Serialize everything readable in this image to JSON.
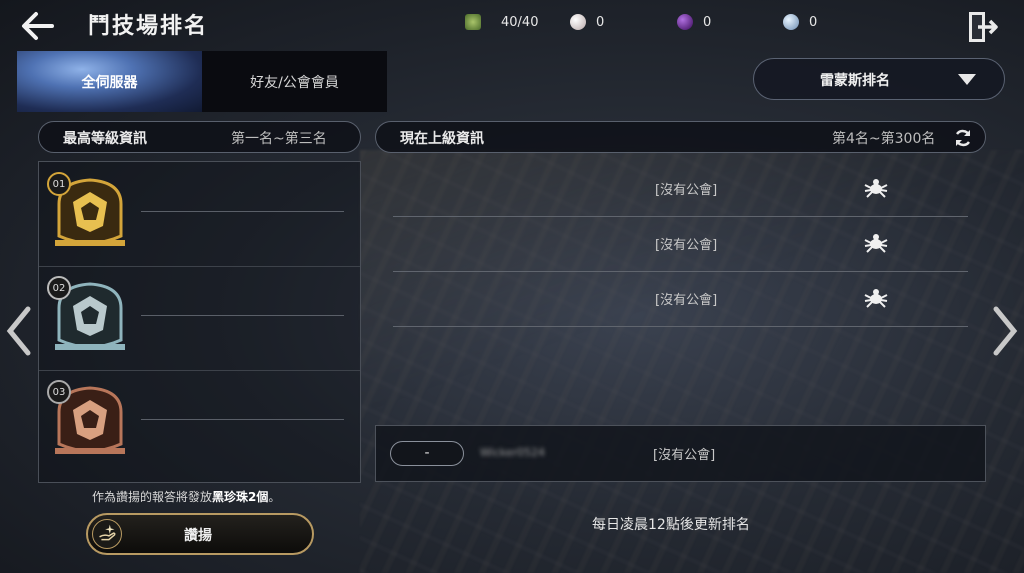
{
  "header": {
    "title": "鬥技場排名",
    "resources": [
      {
        "icon": "arena-token-icon",
        "value": "40/40",
        "color": "#6a8a3a"
      },
      {
        "icon": "white-pearl-icon",
        "value": "0",
        "color": "#d8c8c8"
      },
      {
        "icon": "black-pearl-icon",
        "value": "0",
        "color": "#6a2a8a"
      },
      {
        "icon": "silver-coin-icon",
        "value": "0",
        "color": "#a8c8e8"
      }
    ]
  },
  "tabs": [
    {
      "label": "全伺服器",
      "active": true
    },
    {
      "label": "好友/公會會員",
      "active": false
    }
  ],
  "dropdown": {
    "selected": "雷蒙斯排名"
  },
  "top_panel": {
    "title": "最高等級資訊",
    "range": "第一名~第三名"
  },
  "top_ranks": [
    {
      "rank": "01",
      "tier_color": "#d4a53a"
    },
    {
      "rank": "02",
      "tier_color": "#8fb4bd"
    },
    {
      "rank": "03",
      "tier_color": "#b8765a"
    }
  ],
  "list_panel": {
    "title": "現在上級資訊",
    "range": "第4名~第300名"
  },
  "rank_rows": [
    {
      "guild": "[沒有公會]"
    },
    {
      "guild": "[沒有公會]"
    },
    {
      "guild": "[沒有公會]"
    }
  ],
  "my_row": {
    "rank": "-",
    "name": "Wicker0524",
    "guild": "[沒有公會]"
  },
  "cheer": {
    "note_prefix": "作為讚揚的報答將發放",
    "note_highlight": "黑珍珠2個",
    "note_suffix": "。",
    "button_label": "讚揚"
  },
  "update_note": "每日凌晨12點後更新排名"
}
